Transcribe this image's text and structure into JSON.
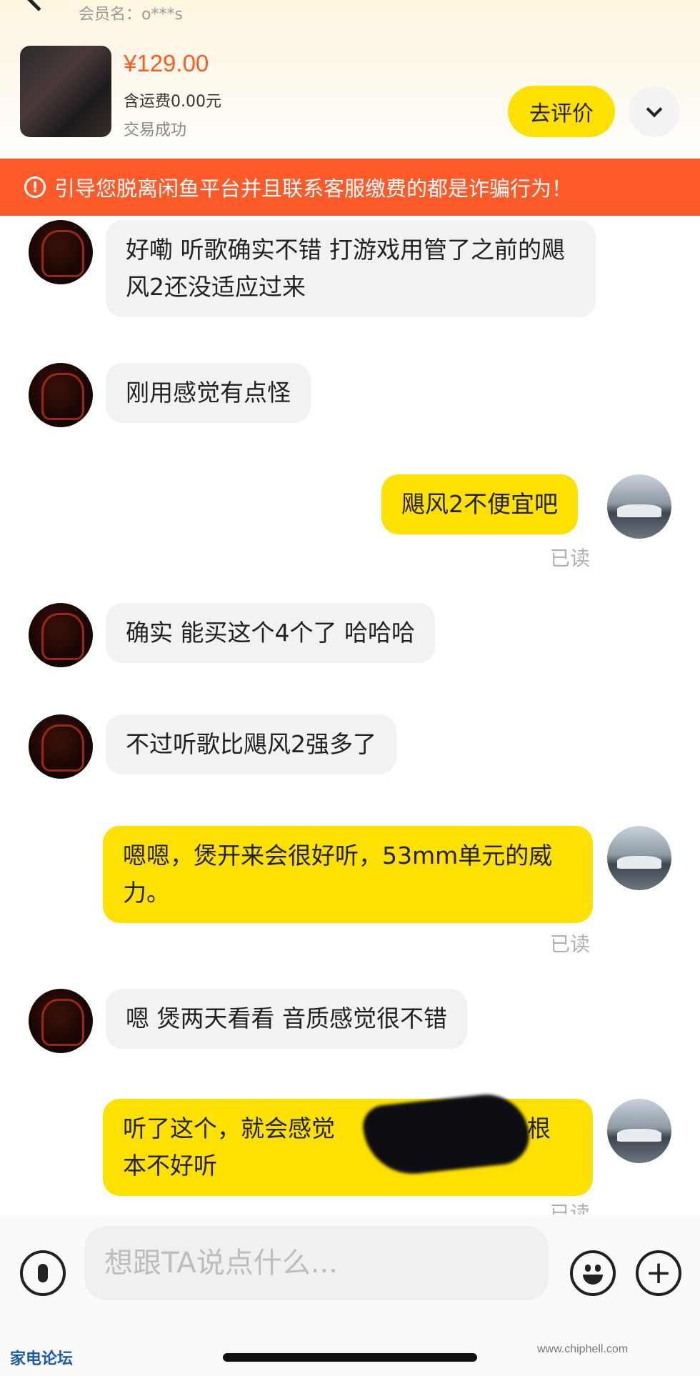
{
  "header": {
    "member_label": "会员名：o***s",
    "price": "¥129.00",
    "shipping": "含运费0.00元",
    "status": "交易成功",
    "review_button": "去评价"
  },
  "warning": {
    "icon": "!",
    "text": "引导您脱离闲鱼平台并且联系客服缴费的都是诈骗行为！"
  },
  "messages": {
    "m1": "好嘞 听歌确实不错 打游戏用管了之前的飓风2还没适应过来",
    "m2": "刚用感觉有点怪",
    "m3": "飓风2不便宜吧",
    "m4": "确实 能买这个4个了 哈哈哈",
    "m5": "不过听歌比飓风2强多了",
    "m6": "嗯嗯，煲开来会很好听，53mm单元的威力。",
    "m7": "嗯 煲两天看看 音质感觉很不错",
    "m8": "听了这个，就会感觉",
    "m8_tail": "啥的，根本不好听",
    "read_label": "已读"
  },
  "input": {
    "placeholder": "想跟TA说点什么..."
  },
  "watermarks": {
    "left": "家电论坛",
    "right": "www.chiphell.com"
  },
  "colors": {
    "accent_yellow": "#ffe100",
    "warning_orange": "#ff5a2a",
    "price_orange": "#ff5a1f"
  }
}
